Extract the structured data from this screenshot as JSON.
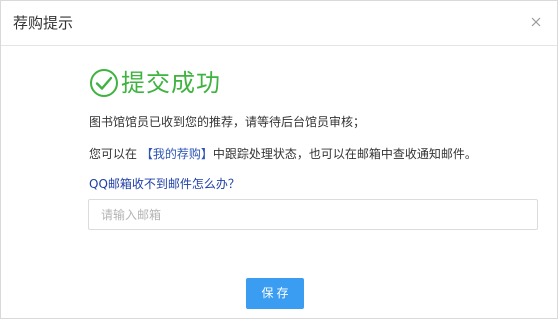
{
  "dialog": {
    "title": "荐购提示",
    "close_icon": "close-icon"
  },
  "success": {
    "icon": "check-circle-icon",
    "text": "提交成功",
    "color": "#3eb33f"
  },
  "messages": {
    "line1": "图书馆馆员已收到您的推荐，请等待后台馆员审核；",
    "line2_prefix": "您可以在 ",
    "line2_link": "【我的荐购】",
    "line2_suffix": "中跟踪处理状态，也可以在邮箱中查收通知邮件。"
  },
  "qq_help": {
    "text": "QQ邮箱收不到邮件怎么办？"
  },
  "email": {
    "value": "",
    "placeholder": "请输入邮箱"
  },
  "actions": {
    "save_label": "保存",
    "save_color": "#3a9df2"
  }
}
